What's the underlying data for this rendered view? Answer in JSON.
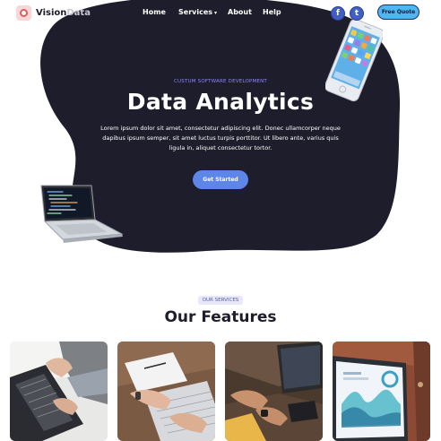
{
  "brand": {
    "name_main": "Vision",
    "name_faded": "Data"
  },
  "nav": {
    "items": [
      {
        "label": "Home"
      },
      {
        "label": "Services",
        "chevron": "▾"
      },
      {
        "label": "About"
      },
      {
        "label": "Help"
      }
    ],
    "social": [
      {
        "icon": "facebook-icon",
        "glyph": "f"
      },
      {
        "icon": "twitter-icon",
        "glyph": "t"
      }
    ],
    "quote_label": "Free Quote"
  },
  "hero": {
    "eyebrow": "CUSTUM SOFTWARE DEVELOPMENT",
    "title": "Data Analytics",
    "text": "Lorem ipsum dolor sit amet, consectetur adipiscing elit. Donec ullamcorper neque dapibus ipsum semper, sit amet luctus turpis porttitor. Ut libero ante, varius quis ligula in, aliquet consectetur tortor.",
    "cta_label": "Get Started"
  },
  "features": {
    "badge": "OUR SERVICES",
    "title": "Our Features",
    "cards": [
      {
        "image": "laptop-typing-photo"
      },
      {
        "image": "notebook-keyboard-photo"
      },
      {
        "image": "desk-smartwatch-photo"
      },
      {
        "image": "analytics-screen-photo"
      }
    ]
  },
  "colors": {
    "hero_bg": "#1e1d2b",
    "accent": "#5e86e8",
    "eyebrow": "#8d86ff",
    "quote_button": "#4fb6ef",
    "social": "#3f5fc4",
    "logo": "#e35b5b"
  }
}
